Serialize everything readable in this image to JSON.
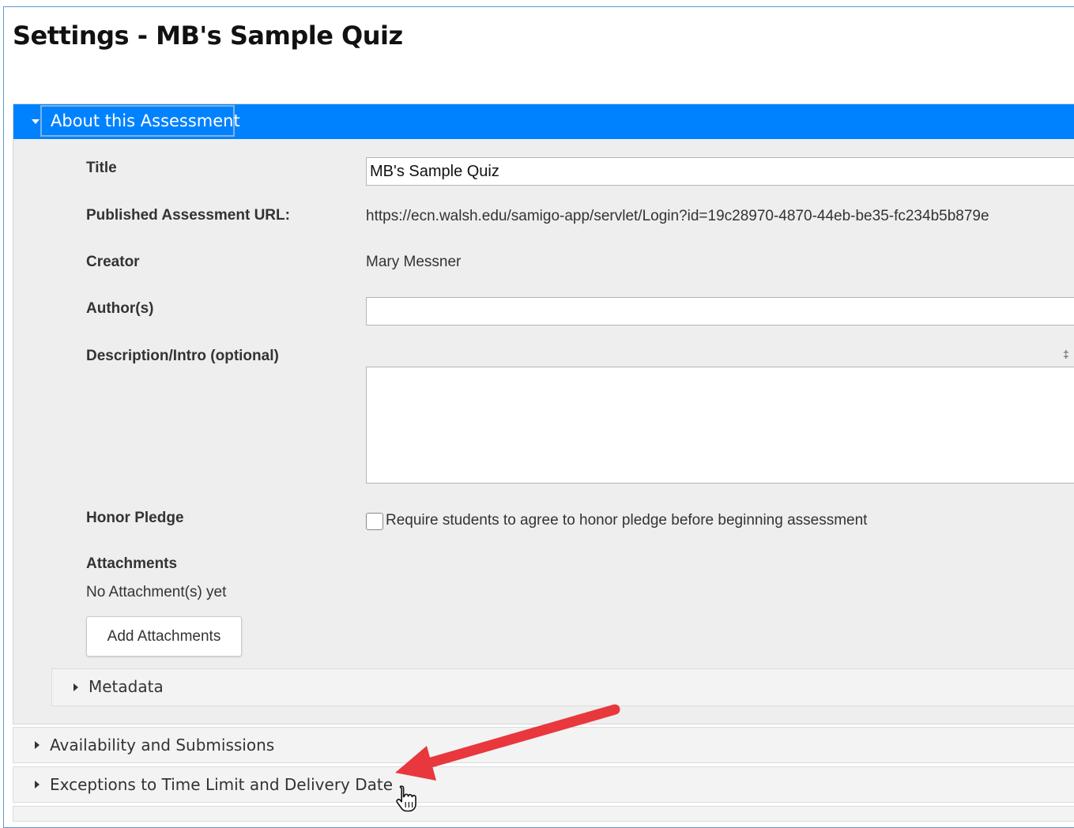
{
  "page": {
    "title": "Settings - MB's Sample Quiz"
  },
  "about_panel": {
    "header_label": "About this Assessment",
    "fields": {
      "title_label": "Title",
      "title_value": "MB's Sample Quiz",
      "url_label": "Published Assessment URL:",
      "url_value": "https://ecn.walsh.edu/samigo-app/servlet/Login?id=19c28970-4870-44eb-be35-fc234b5b879e",
      "creator_label": "Creator",
      "creator_value": "Mary Messner",
      "authors_label": "Author(s)",
      "authors_value": "",
      "description_label": "Description/Intro (optional)",
      "honor_pledge_label": "Honor Pledge",
      "honor_pledge_checkbox_label": "Require students to agree to honor pledge before beginning assessment",
      "honor_pledge_checked": false,
      "attachments_label": "Attachments",
      "attachments_status": "No Attachment(s) yet",
      "add_attachments_button": "Add Attachments"
    },
    "metadata_label": "Metadata"
  },
  "sections": [
    {
      "label": "Availability and Submissions"
    },
    {
      "label": "Exceptions to Time Limit and Delivery Date"
    }
  ],
  "colors": {
    "header_blue": "#0082ff",
    "panel_gray": "#eeeeee",
    "annotation_arrow": "#e8373d"
  },
  "icons": {
    "expanded": "caret-down-icon",
    "collapsed": "caret-right-icon",
    "cursor": "hand-pointer-icon",
    "annotation": "red-arrow-annotation"
  }
}
